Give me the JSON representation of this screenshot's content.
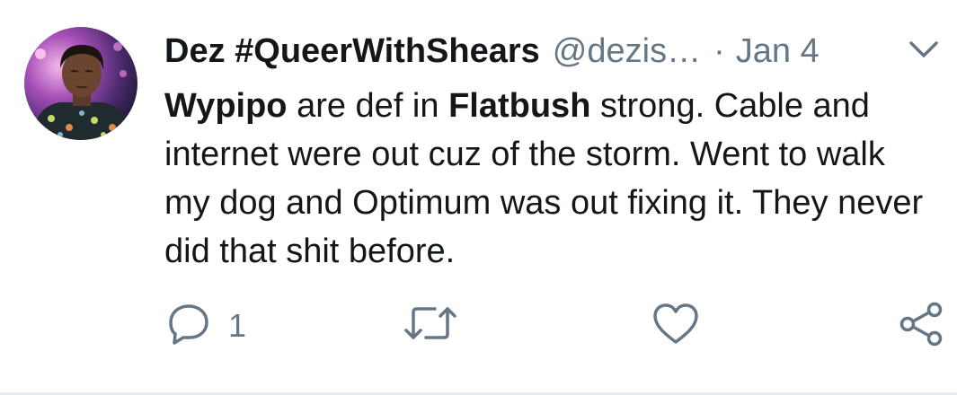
{
  "tweet": {
    "display_name": "Dez #QueerWithShears",
    "handle": "@dezis…",
    "separator": "·",
    "date": "Jan 4",
    "menu_icon": "chevron-down-icon",
    "body": {
      "p1_bold": "Wypipo",
      "p2": " are def in ",
      "p3_bold": "Flatbush",
      "p4": " strong. Cable and internet were out cuz of the storm. Went to walk my dog and Optimum was out fixing it. They never did that shit before."
    },
    "actions": {
      "reply_icon": "reply-icon",
      "reply_count": "1",
      "retweet_icon": "retweet-icon",
      "like_icon": "heart-icon",
      "share_icon": "share-icon"
    }
  },
  "colors": {
    "text": "#14171a",
    "secondary": "#657786",
    "divider": "#e6ecf0",
    "background": "#ffffff"
  }
}
